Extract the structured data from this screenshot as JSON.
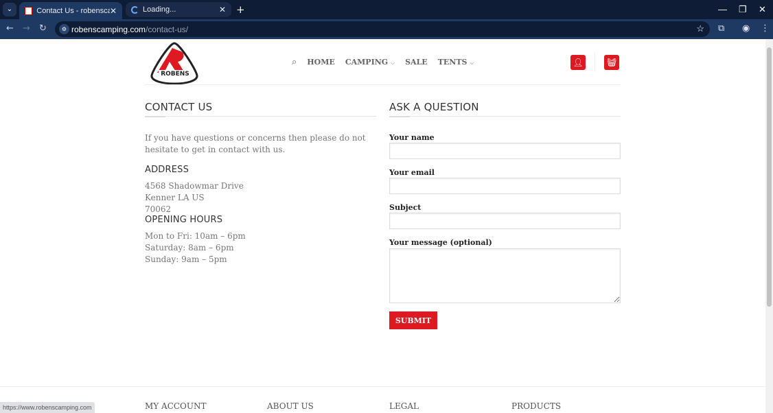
{
  "browser": {
    "tabs": [
      {
        "title": "Contact Us - robenscamping.co",
        "active": true
      },
      {
        "title": "Loading...",
        "active": false
      }
    ],
    "url_host": "robenscamping.com",
    "url_path": "/contact-us/",
    "status_url": "https://www.robenscamping.com"
  },
  "header": {
    "logo_text": "ROBENS",
    "menu": [
      {
        "label": "HOME"
      },
      {
        "label": "CAMPING",
        "dropdown": true
      },
      {
        "label": "SALE"
      },
      {
        "label": "TENTS",
        "dropdown": true
      }
    ],
    "accent": "#dd1a22"
  },
  "contact": {
    "title": "CONTACT US",
    "intro": "If you have questions or concerns then please do not hesitate to get in contact with us.",
    "address_title": "ADDRESS",
    "address": [
      "4568 Shadowmar Drive",
      "Kenner LA US",
      "70062"
    ],
    "hours_title": "OPENING HOURS",
    "hours": [
      "Mon to Fri: 10am – 6pm",
      "Saturday: 8am – 6pm",
      "Sunday: 9am – 5pm"
    ]
  },
  "form": {
    "title": "ASK A QUESTION",
    "name_label": "Your name",
    "name_value": "",
    "email_label": "Your email",
    "email_value": "",
    "subject_label": "Subject",
    "subject_value": "",
    "message_label": "Your message (optional)",
    "message_value": "",
    "submit": "SUBMIT"
  },
  "footer": {
    "columns": [
      "MY ACCOUNT",
      "ABOUT US",
      "LEGAL",
      "PRODUCTS"
    ]
  }
}
